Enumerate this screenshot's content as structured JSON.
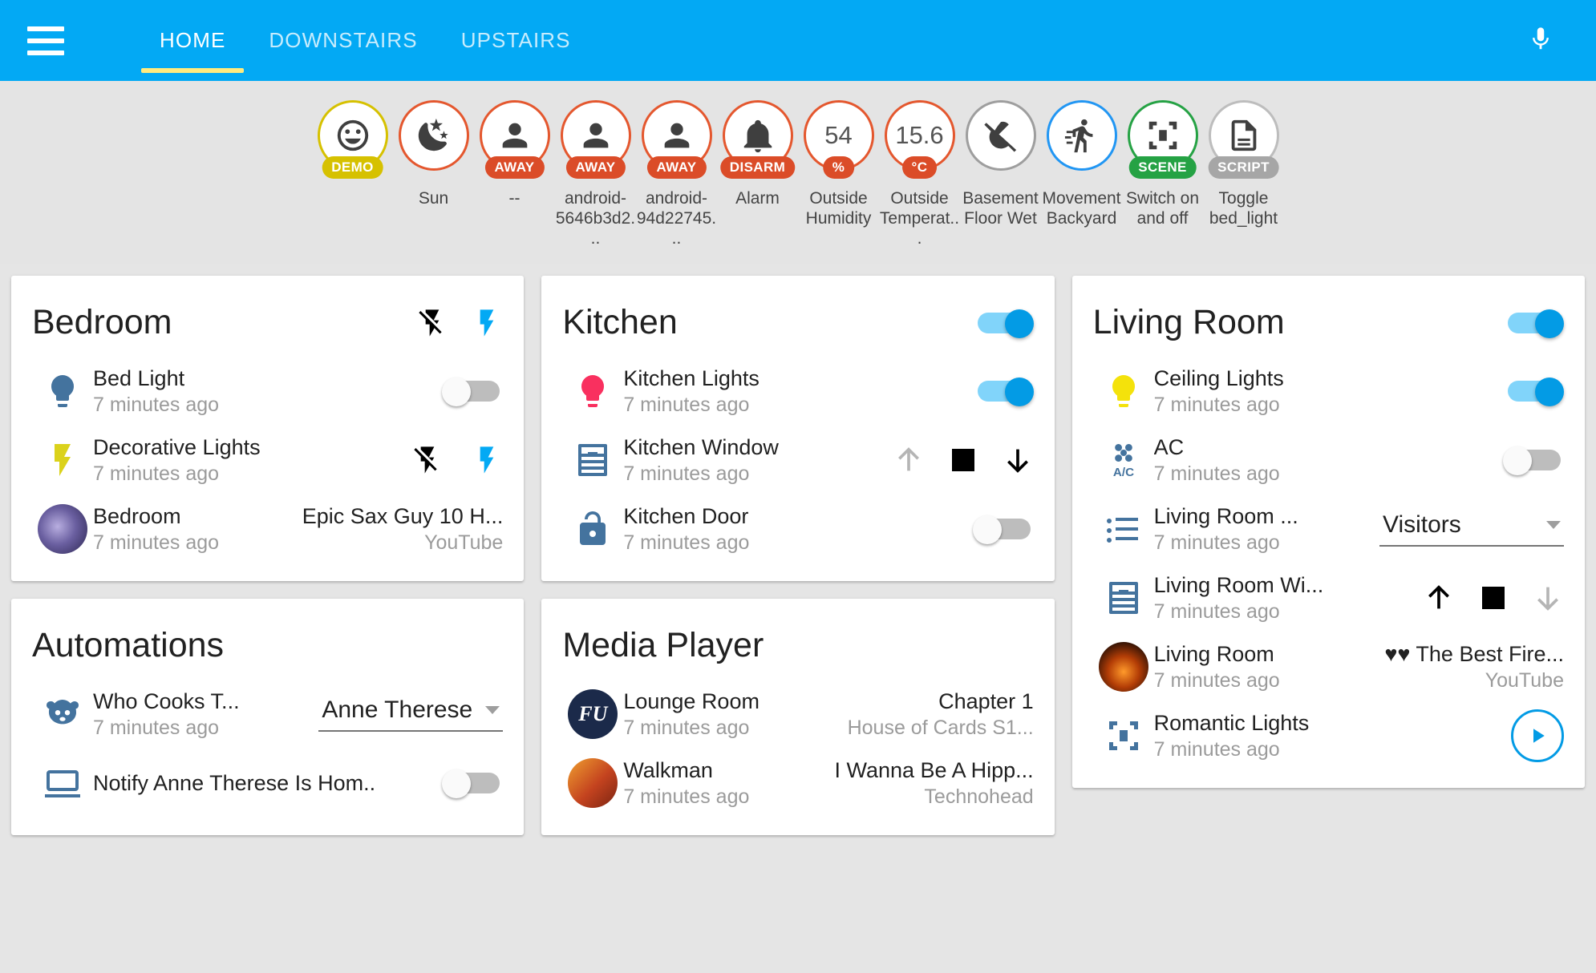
{
  "header": {
    "menu_icon": "hamburger-menu-icon",
    "mic_icon": "microphone-icon",
    "tabs": [
      {
        "label": "HOME",
        "active": true
      },
      {
        "label": "DOWNSTAIRS",
        "active": false
      },
      {
        "label": "UPSTAIRS",
        "active": false
      }
    ],
    "accent_color": "#03a9f4",
    "active_tab_underline_color": "#ffeb7f"
  },
  "badges": [
    {
      "icon": "emoticon-happy-icon",
      "value": "",
      "pill": "DEMO",
      "pill_color": "#d6c100",
      "ring_color": "#d6c100",
      "name": ""
    },
    {
      "icon": "weather-night-moon-icon",
      "value": "",
      "pill": "",
      "pill_color": "",
      "ring_color": "#e4572e",
      "name": "Sun"
    },
    {
      "icon": "account-person-icon",
      "value": "",
      "pill": "AWAY",
      "pill_color": "#db4c28",
      "ring_color": "#e4572e",
      "name": "--"
    },
    {
      "icon": "account-person-icon",
      "value": "",
      "pill": "AWAY",
      "pill_color": "#db4c28",
      "ring_color": "#e4572e",
      "name": "android-5646b3d2..."
    },
    {
      "icon": "account-person-icon",
      "value": "",
      "pill": "AWAY",
      "pill_color": "#db4c28",
      "ring_color": "#e4572e",
      "name": "android-94d22745..."
    },
    {
      "icon": "bell-alarm-icon",
      "value": "",
      "pill": "DISARM",
      "pill_color": "#db4c28",
      "ring_color": "#e4572e",
      "name": "Alarm"
    },
    {
      "icon": "humidity-value-icon",
      "value": "54",
      "pill": "%",
      "pill_color": "#db4c28",
      "ring_color": "#e4572e",
      "name": "Outside Humidity"
    },
    {
      "icon": "temperature-value-icon",
      "value": "15.6",
      "pill": "°C",
      "pill_color": "#db4c28",
      "ring_color": "#e4572e",
      "name": "Outside Temperat..."
    },
    {
      "icon": "water-off-icon",
      "value": "",
      "pill": "",
      "pill_color": "",
      "ring_color": "#9e9e9e",
      "name": "Basement Floor Wet"
    },
    {
      "icon": "run-motion-icon",
      "value": "",
      "pill": "",
      "pill_color": "",
      "ring_color": "#2196f3",
      "name": "Movement Backyard"
    },
    {
      "icon": "scene-palette-icon",
      "value": "",
      "pill": "SCENE",
      "pill_color": "#25a244",
      "ring_color": "#25a244",
      "name": "Switch on and off"
    },
    {
      "icon": "script-document-icon",
      "value": "",
      "pill": "SCRIPT",
      "pill_color": "#a6a6a6",
      "ring_color": "#bdbdbd",
      "name": "Toggle bed_light"
    }
  ],
  "cards": {
    "bedroom": {
      "title": "Bedroom",
      "header_actions": [
        "flash-off-icon",
        "flash-on-icon"
      ],
      "rows": [
        {
          "icon": "lightbulb-icon",
          "icon_color": "#44739e",
          "name": "Bed Light",
          "sub": "7 minutes ago",
          "control": "toggle",
          "toggle_on": false
        },
        {
          "icon": "flash-lightning-icon",
          "icon_color": "#dbd21b",
          "name": "Decorative Lights",
          "sub": "7 minutes ago",
          "control": "flash-buttons"
        },
        {
          "icon": "media-artwork-avatar",
          "icon_color": "",
          "name": "Bedroom",
          "sub": "7 minutes ago",
          "control": "media-text",
          "media_title": "Epic Sax Guy 10 H...",
          "media_source": "YouTube"
        }
      ]
    },
    "automations": {
      "title": "Automations",
      "rows": [
        {
          "icon": "panda-robot-icon",
          "icon_color": "#44739e",
          "name": "Who Cooks T...",
          "sub": "7 minutes ago",
          "control": "dropdown",
          "dropdown_value": "Anne Therese"
        },
        {
          "icon": "laptop-icon",
          "icon_color": "#44739e",
          "name": "Notify Anne Therese Is Hom..",
          "sub": "",
          "control": "toggle",
          "toggle_on": false
        }
      ]
    },
    "kitchen": {
      "title": "Kitchen",
      "header_toggle_on": true,
      "rows": [
        {
          "icon": "lightbulb-icon",
          "icon_color": "#f9305f",
          "name": "Kitchen Lights",
          "sub": "7 minutes ago",
          "control": "toggle",
          "toggle_on": true
        },
        {
          "icon": "window-shutter-icon",
          "icon_color": "#44739e",
          "name": "Kitchen Window",
          "sub": "7 minutes ago",
          "control": "cover",
          "up_enabled": false,
          "down_enabled": true
        },
        {
          "icon": "lock-open-icon",
          "icon_color": "#44739e",
          "name": "Kitchen Door",
          "sub": "7 minutes ago",
          "control": "toggle",
          "toggle_on": false
        }
      ]
    },
    "media_player": {
      "title": "Media Player",
      "rows": [
        {
          "icon": "media-artwork-avatar-fu",
          "icon_color": "",
          "name": "Lounge Room",
          "sub": "7 minutes ago",
          "control": "media-text",
          "media_title": "Chapter 1",
          "media_source": "House of Cards S1..."
        },
        {
          "icon": "media-artwork-avatar-walkman",
          "icon_color": "",
          "name": "Walkman",
          "sub": "7 minutes ago",
          "control": "media-text",
          "media_title": "I Wanna Be A Hipp...",
          "media_source": "Technohead"
        }
      ]
    },
    "living_room": {
      "title": "Living Room",
      "header_toggle_on": true,
      "rows": [
        {
          "icon": "lightbulb-icon",
          "icon_color": "#f4e20b",
          "name": "Ceiling Lights",
          "sub": "7 minutes ago",
          "control": "toggle",
          "toggle_on": true
        },
        {
          "icon": "air-conditioner-icon",
          "icon_color": "#44739e",
          "name": "AC",
          "sub": "7 minutes ago",
          "control": "toggle",
          "toggle_on": false
        },
        {
          "icon": "format-list-icon",
          "icon_color": "#44739e",
          "name": "Living Room ...",
          "sub": "7 minutes ago",
          "control": "dropdown",
          "dropdown_value": "Visitors"
        },
        {
          "icon": "window-shutter-icon",
          "icon_color": "#44739e",
          "name": "Living Room Wi...",
          "sub": "7 minutes ago",
          "control": "cover",
          "up_enabled": true,
          "down_enabled": false
        },
        {
          "icon": "media-artwork-avatar-fire",
          "icon_color": "",
          "name": "Living Room",
          "sub": "7 minutes ago",
          "control": "media-text",
          "media_title": "♥♥ The Best Fire...",
          "media_source": "YouTube"
        },
        {
          "icon": "scene-palette-icon",
          "icon_color": "#44739e",
          "name": "Romantic Lights",
          "sub": "7 minutes ago",
          "control": "play-button"
        }
      ]
    }
  }
}
